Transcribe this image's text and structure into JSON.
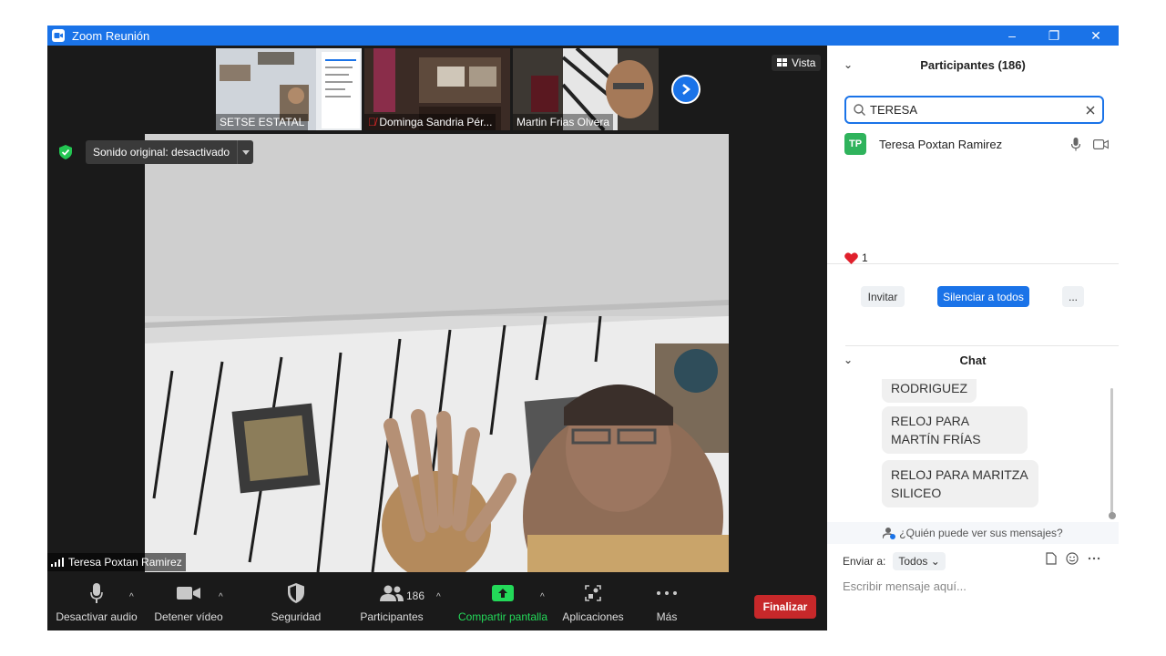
{
  "window": {
    "title": "Zoom Reunión",
    "minimize": "–",
    "restore": "❐",
    "close": "✕"
  },
  "gallery": {
    "thumbnails": [
      {
        "name": "SETSE ESTATAL"
      },
      {
        "name": "Dominga Sandria Pér..."
      },
      {
        "name": "Martin Frias Olvera"
      }
    ],
    "view_label": "Vista"
  },
  "audio": {
    "original_sound": "Sonido original: desactivado"
  },
  "speaker": {
    "name": "Teresa Poxtan Ramirez"
  },
  "toolbar": {
    "mute": "Desactivar audio",
    "video": "Detener vídeo",
    "security": "Seguridad",
    "participants": "Participantes",
    "participants_count": "186",
    "share": "Compartir pantalla",
    "apps": "Aplicaciones",
    "more": "Más",
    "end": "Finalizar"
  },
  "participants_panel": {
    "title": "Participantes (186)",
    "search_value": "TERESA",
    "results": [
      {
        "initials": "TP",
        "name": "Teresa Poxtan Ramirez"
      }
    ],
    "reaction_count": "1",
    "invite": "Invitar",
    "mute_all": "Silenciar a todos",
    "more": "..."
  },
  "chat": {
    "title": "Chat",
    "messages": [
      "RODRIGUEZ",
      "RELOJ PARA MARTÍN FRÍAS",
      "RELOJ PARA  MARITZA SILICEO"
    ],
    "who_can_see": "¿Quién puede ver sus mensajes?",
    "send_to_label": "Enviar a:",
    "send_to_value": "Todos",
    "input_placeholder": "Escribir mensaje aquí..."
  },
  "colors": {
    "accent": "#1a73e8",
    "end": "#c7282a",
    "share": "#23d959",
    "avatar": "#2fb35c"
  }
}
